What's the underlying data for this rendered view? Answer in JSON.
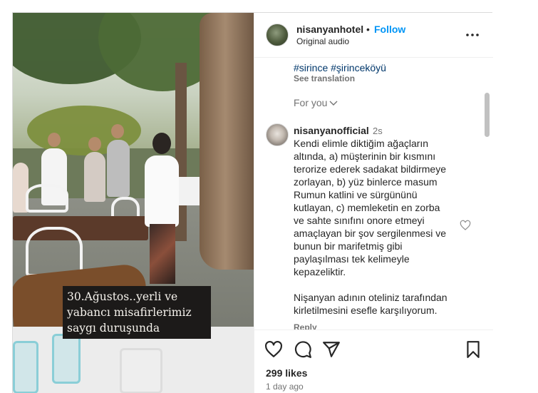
{
  "header": {
    "username": "nisanyanhotel",
    "separator": "•",
    "follow_label": "Follow",
    "audio": "Original audio",
    "more_icon": "more-horizontal-icon"
  },
  "media": {
    "caption_lines": [
      "30.Ağustos..yerli ve",
      "yabancı misafirlerimiz",
      "saygı duruşunda"
    ]
  },
  "caption": {
    "hashtags": "#sirince #şirinceköyü",
    "see_translation": "See translation"
  },
  "for_you": {
    "label": "For you",
    "icon": "chevron-down-icon"
  },
  "comment": {
    "username": "nisanyanofficial",
    "time": "2s",
    "lines": [
      "Kendi elimle diktiğim ağaçların",
      "altında, a) müşterinin bir kısmını",
      "terorize ederek sadakat bildirmeye",
      "zorlayan, b) yüz binlerce masum",
      "Rumun katlini ve sürgününü",
      "kutlayan, c) memleketin en zorba",
      "ve sahte sınıfını onore etmeyi",
      "amaçlayan bir şov sergilenmesi ve",
      "bunun bir marifetmiş gibi",
      "paylaşılması tek kelimeyle",
      "kepazeliktir."
    ],
    "lines2": [
      "Nişanyan adının oteliniz tarafından",
      "kirletilmesini esefle karşılıyorum."
    ],
    "reply_label": "Reply",
    "like_icon": "heart-outline-icon"
  },
  "actions": {
    "icons": [
      "heart-icon",
      "comment-icon",
      "share-icon",
      "bookmark-icon"
    ],
    "likes": "299 likes",
    "time_ago": "1 day ago"
  },
  "colors": {
    "link_blue": "#0095f6",
    "hashtag": "#00376b",
    "muted": "#737373",
    "text": "#262626"
  }
}
